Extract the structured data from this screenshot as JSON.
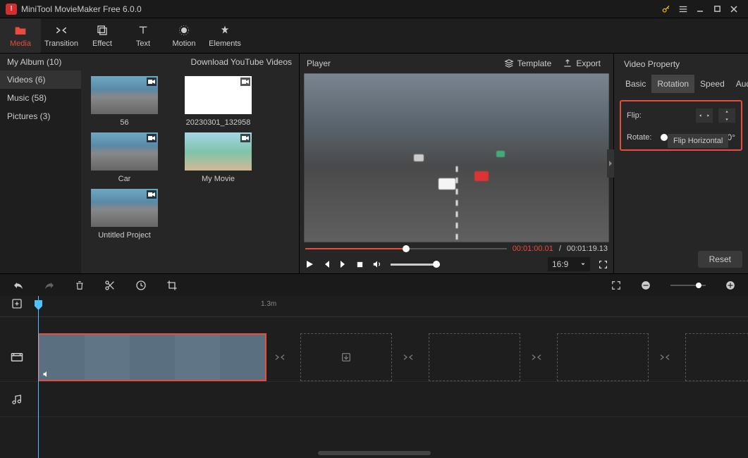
{
  "titlebar": {
    "app_title": "MiniTool MovieMaker Free 6.0.0"
  },
  "toolbar": {
    "tabs": [
      {
        "label": "Media"
      },
      {
        "label": "Transition"
      },
      {
        "label": "Effect"
      },
      {
        "label": "Text"
      },
      {
        "label": "Motion"
      },
      {
        "label": "Elements"
      }
    ]
  },
  "left": {
    "album_label": "My Album (10)",
    "download_label": "Download YouTube Videos",
    "sidebar": [
      {
        "label": "Videos (6)"
      },
      {
        "label": "Music (58)"
      },
      {
        "label": "Pictures (3)"
      }
    ],
    "media": [
      {
        "label": "56"
      },
      {
        "label": "20230301_132958"
      },
      {
        "label": "Car"
      },
      {
        "label": "My Movie"
      },
      {
        "label": "Untitled Project"
      }
    ]
  },
  "player": {
    "title": "Player",
    "template_label": "Template",
    "export_label": "Export",
    "time_current": "00:01:00.01",
    "time_sep": " / ",
    "time_duration": "00:01:19.13",
    "ratio": "16:9"
  },
  "props": {
    "title": "Video Property",
    "tabs": [
      {
        "label": "Basic"
      },
      {
        "label": "Rotation"
      },
      {
        "label": "Speed"
      },
      {
        "label": "Audio"
      }
    ],
    "flip_label": "Flip:",
    "tooltip": "Flip Horizontal",
    "rotate_label": "Rotate:",
    "rotate_value": "0°",
    "reset_label": "Reset"
  },
  "timeline": {
    "ruler_mark": "1.3m"
  }
}
